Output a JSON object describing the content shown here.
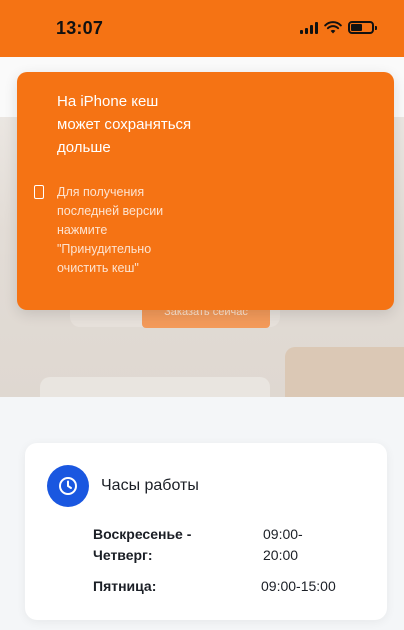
{
  "status_bar": {
    "time": "13:07"
  },
  "hero": {
    "cta_label": "Заказать сейчас"
  },
  "toast": {
    "title": "На iPhone кеш может сохраняться дольше",
    "body": "Для получения последней версии нажмите \"Принудительно очистить кеш\"",
    "icon": "phone-icon"
  },
  "hours": {
    "title": "Часы работы",
    "icon": "clock-icon",
    "rows": [
      {
        "days": "Воскресенье - Четверг:",
        "time": "09:00-20:00"
      },
      {
        "days": "Пятница:",
        "time": "09:00-15:00"
      }
    ]
  },
  "colors": {
    "brand": "#f57314",
    "accent_blue": "#1a57e0"
  }
}
